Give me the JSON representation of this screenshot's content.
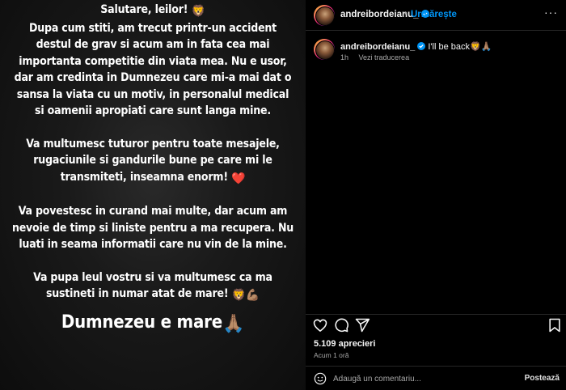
{
  "story": {
    "lines": {
      "greeting": "Salutare, leilor!",
      "p1": [
        "Dupa cum stiti, am trecut printr-un accident",
        "destul de grav si acum am in fata cea mai",
        "importanta competitie din viata mea. Nu e usor,",
        "dar am credinta in Dumnezeu care mi-a mai dat o",
        "sansa la viata cu un motiv, in personalul medical",
        "si oamenii apropiati care sunt langa mine."
      ],
      "p2": [
        "Va multumesc tuturor pentru toate mesajele,",
        "rugaciunile si gandurile bune pe care mi le",
        "transmiteti, inseamna enorm!"
      ],
      "p3": [
        "Va povestesc in curand mai multe, dar acum am",
        "nevoie de timp si liniste pentru a ma recupera. Nu",
        "luati in seama informatii care nu vin de la mine."
      ],
      "p4": [
        "Va pupa leul vostru si va multumesc ca ma",
        "sustineti in numar atat de mare!"
      ],
      "closing": "Dumnezeu e mare"
    },
    "emojis": {
      "lion": "🦁",
      "heart": "❤️",
      "muscle": "💪🏽",
      "pray": "🙏🏽"
    }
  },
  "post": {
    "username": "andreibordeianu_",
    "separator": "•",
    "follow_label": "Urmărește",
    "more_label": "···",
    "caption_text": "I'll be back",
    "caption_emojis": "🦁🙏🏽",
    "age": "1h",
    "translate_label": "Vezi traducerea",
    "likes": "5.109 aprecieri",
    "timestamp": "Acum 1 oră",
    "comment_placeholder": "Adaugă un comentariu...",
    "post_label": "Postează"
  },
  "colors": {
    "accent": "#0095f6",
    "background": "#000000",
    "text": "#f5f5f5",
    "muted": "#a8a8a8"
  },
  "icons": [
    "verified-icon",
    "more-icon",
    "heart-icon",
    "comment-icon",
    "share-icon",
    "bookmark-icon",
    "emoji-icon"
  ]
}
